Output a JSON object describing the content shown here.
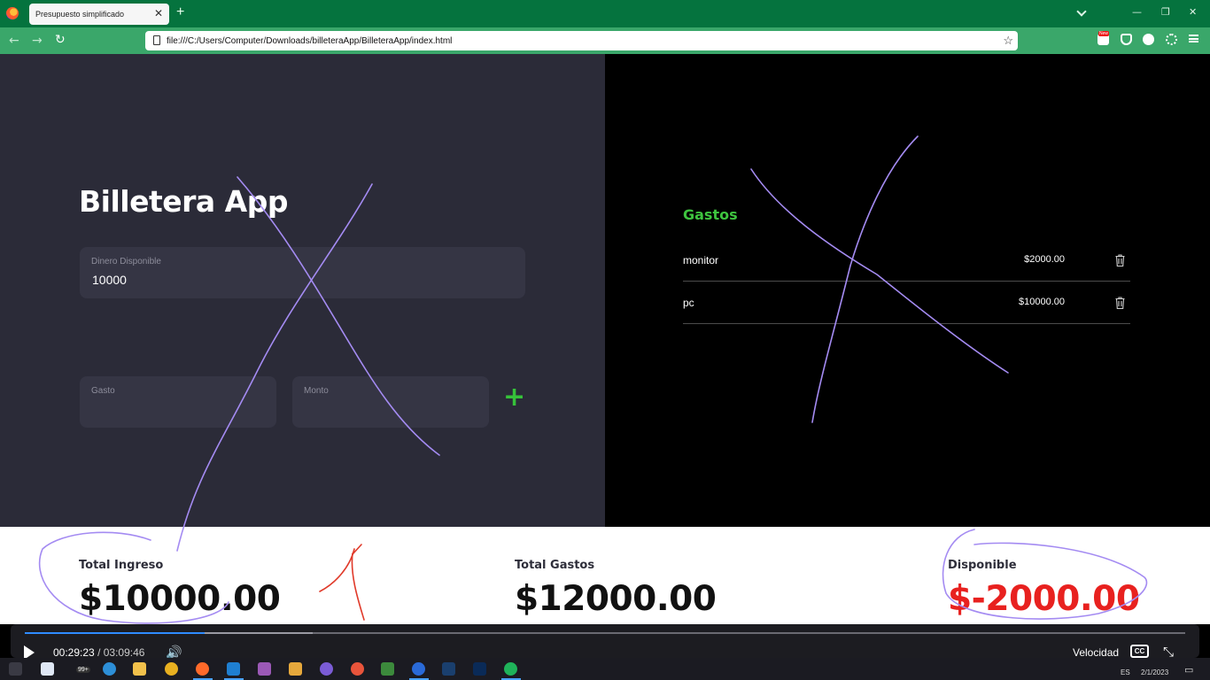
{
  "browser": {
    "tab_title": "Presupuesto simplificado",
    "new_tab_label": "+",
    "url": "file:///C:/Users/Computer/Downloads/billeteraApp/BilleteraApp/index.html",
    "extension_badge": "New",
    "accent_color": "#05733e"
  },
  "app": {
    "title": "Billetera App",
    "available_money": {
      "label": "Dinero Disponible",
      "value": "10000"
    },
    "expense_input": {
      "label": "Gasto",
      "value": ""
    },
    "amount_input": {
      "label": "Monto",
      "value": ""
    },
    "add_button_label": "+"
  },
  "expenses": {
    "title": "Gastos",
    "title_color": "#3ec43f",
    "items": [
      {
        "name": "monitor",
        "amount": "$2000.00"
      },
      {
        "name": "pc",
        "amount": "$10000.00"
      }
    ]
  },
  "summary": {
    "income_label": "Total Ingreso",
    "income_value": "$10000.00",
    "expenses_label": "Total Gastos",
    "expenses_value": "$12000.00",
    "available_label": "Disponible",
    "available_value": "$-2000.00",
    "negative_color": "#e8211f"
  },
  "player": {
    "current_time": "00:29:23",
    "separator": "/",
    "duration": "03:09:46",
    "progress_fraction": 0.155,
    "buffered_fraction": 0.248,
    "speed_label": "Velocidad",
    "cc_label": "CC"
  },
  "taskbar": {
    "badge": "99+",
    "language": "ES",
    "date": "2/1/2023"
  }
}
